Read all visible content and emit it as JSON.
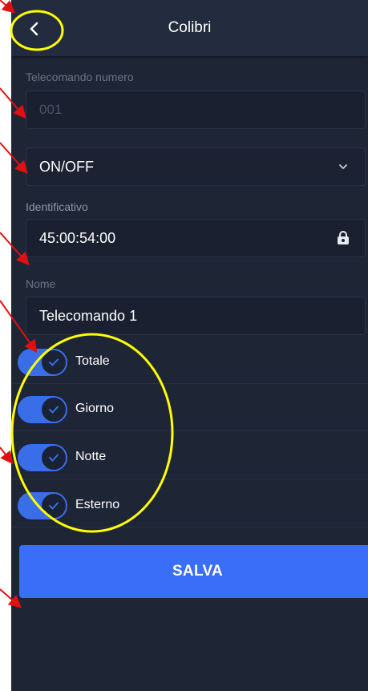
{
  "header": {
    "title": "Colibri",
    "back_icon": "chevron-left-icon"
  },
  "remote_number": {
    "label": "Telecomando numero",
    "value": "001"
  },
  "mode_select": {
    "value": "ON/OFF",
    "icon": "chevron-down-icon"
  },
  "identifier": {
    "label": "Identificativo",
    "value": "45:00:54:00",
    "icon": "lock-icon"
  },
  "name": {
    "label": "Nome",
    "value": "Telecomando 1"
  },
  "toggles": [
    {
      "label": "Totale",
      "on": true
    },
    {
      "label": "Giorno",
      "on": true
    },
    {
      "label": "Notte",
      "on": true
    },
    {
      "label": "Esterno",
      "on": true
    }
  ],
  "save_button": {
    "label": "SALVA"
  },
  "colors": {
    "background": "#1e2535",
    "header": "#232b3e",
    "accent": "#3a6ef8",
    "annotation_arrow": "#e01010",
    "annotation_circle": "#ffff00"
  }
}
